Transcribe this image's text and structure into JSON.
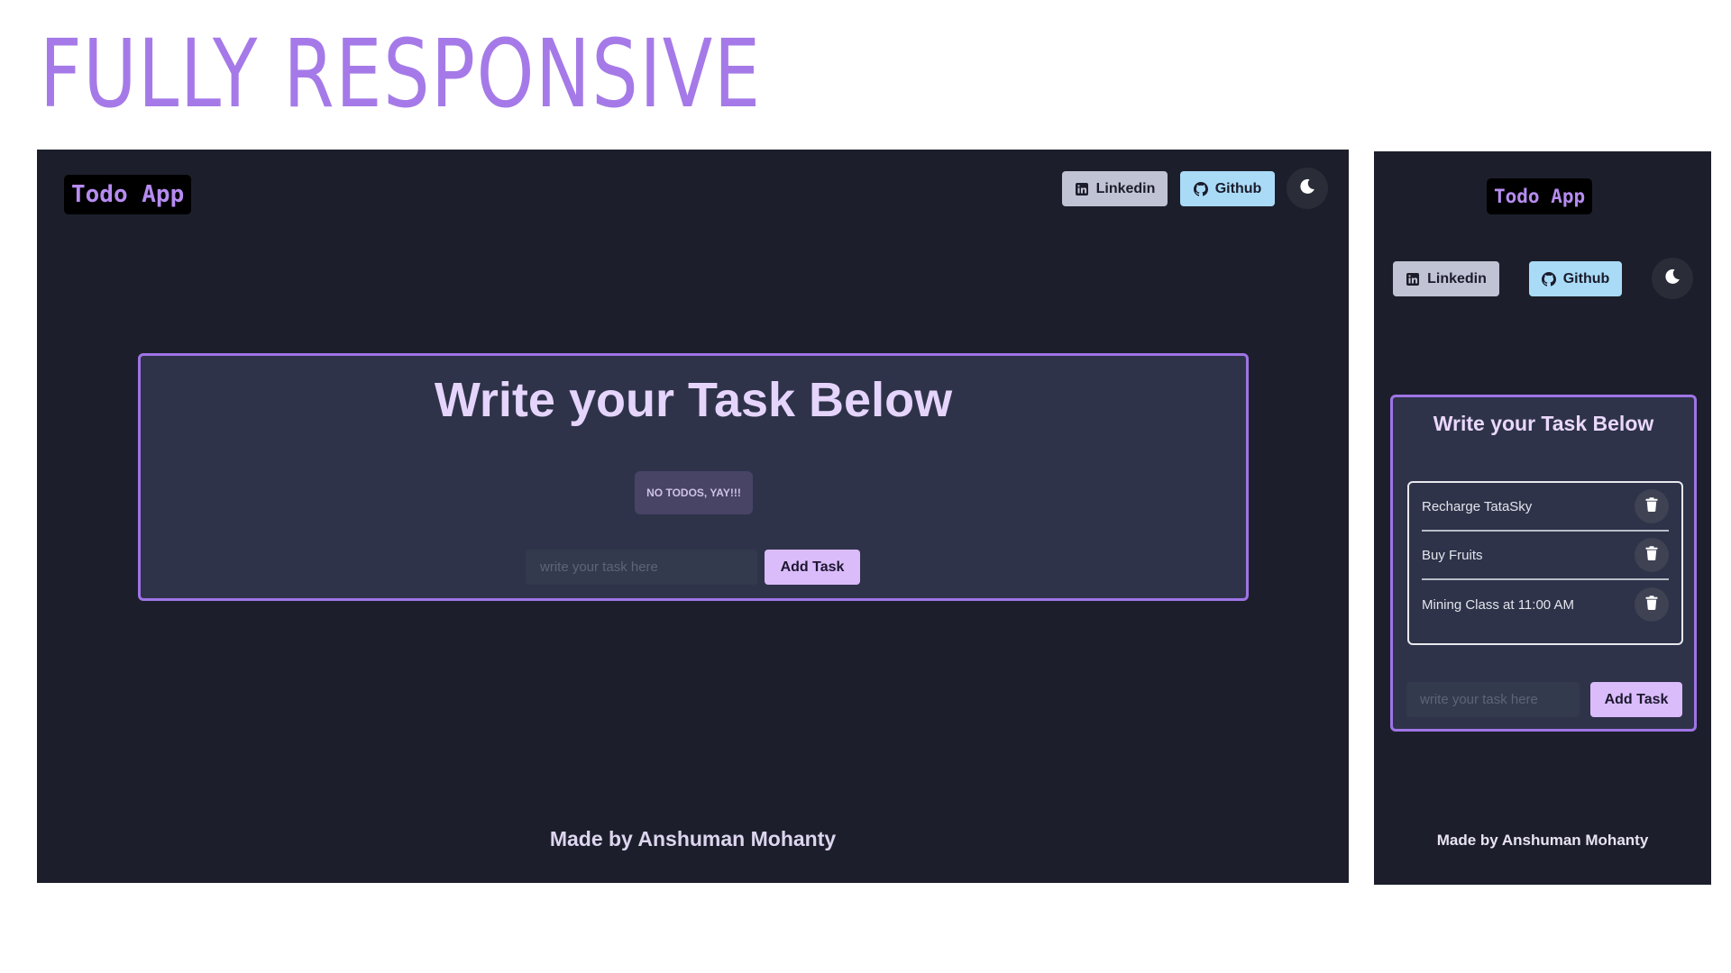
{
  "headline": "FULLY RESPONSIVE",
  "app": {
    "logo": "Todo App",
    "linkedin_label": "Linkedin",
    "github_label": "Github",
    "theme_icon": "moon-icon",
    "task_title": "Write your Task Below",
    "empty_message": "NO TODOS, YAY!!!",
    "input_placeholder": "write your task here",
    "add_label": "Add Task",
    "footer": "Made by Anshuman Mohanty"
  },
  "mobile_todos": [
    {
      "text": "Recharge TataSky"
    },
    {
      "text": "Buy Fruits"
    },
    {
      "text": "Mining Class at 11:00 AM"
    }
  ],
  "colors": {
    "accent": "#9f74e6",
    "background": "#1c1f2b",
    "card": "#2e3349",
    "add_button": "#dbbcfa",
    "github_button": "#a9dbf7",
    "linkedin_button": "#c0c3d4"
  }
}
